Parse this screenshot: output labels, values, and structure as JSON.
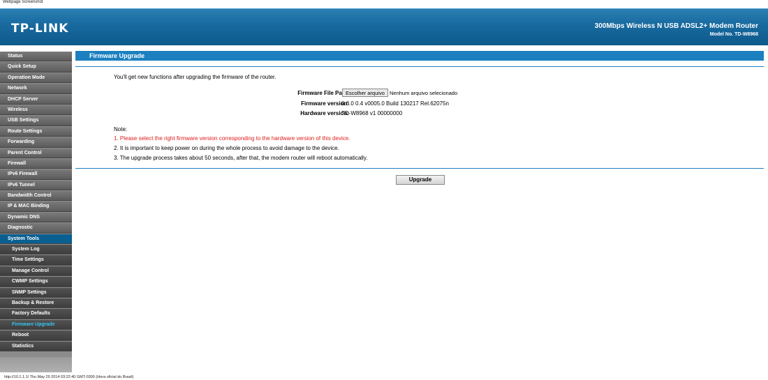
{
  "caption": "Webpage Screenshot",
  "header": {
    "logo": "TP-LINK",
    "product": "300Mbps Wireless N USB ADSL2+ Modem Router",
    "model": "Model No. TD-W8968"
  },
  "sidebar": {
    "items": [
      {
        "label": "Status",
        "type": "top"
      },
      {
        "label": "Quick Setup",
        "type": "top"
      },
      {
        "label": "Operation Mode",
        "type": "top"
      },
      {
        "label": "Network",
        "type": "top"
      },
      {
        "label": "DHCP Server",
        "type": "top"
      },
      {
        "label": "Wireless",
        "type": "top"
      },
      {
        "label": "USB Settings",
        "type": "top"
      },
      {
        "label": "Route Settings",
        "type": "top"
      },
      {
        "label": "Forwarding",
        "type": "top"
      },
      {
        "label": "Parent Control",
        "type": "top"
      },
      {
        "label": "Firewall",
        "type": "top"
      },
      {
        "label": "IPv6 Firewall",
        "type": "top"
      },
      {
        "label": "IPv6 Tunnel",
        "type": "top"
      },
      {
        "label": "Bandwidth Control",
        "type": "top"
      },
      {
        "label": "IP & MAC Binding",
        "type": "top"
      },
      {
        "label": "Dynamic DNS",
        "type": "top"
      },
      {
        "label": "Diagnostic",
        "type": "top"
      },
      {
        "label": "System Tools",
        "type": "active"
      },
      {
        "label": "System Log",
        "type": "sub"
      },
      {
        "label": "Time Settings",
        "type": "sub"
      },
      {
        "label": "Manage Control",
        "type": "sub"
      },
      {
        "label": "CWMP Settings",
        "type": "sub"
      },
      {
        "label": "SNMP Settings",
        "type": "sub"
      },
      {
        "label": "Backup & Restore",
        "type": "sub"
      },
      {
        "label": "Factory Defaults",
        "type": "sub"
      },
      {
        "label": "Firmware Upgrade",
        "type": "current"
      },
      {
        "label": "Reboot",
        "type": "sub"
      },
      {
        "label": "Statistics",
        "type": "sub"
      }
    ]
  },
  "main": {
    "title": "Firmware Upgrade",
    "intro": "You'll get new functions after upgrading the firmware of the router.",
    "file_path_label": "Firmware File Path:",
    "file_button": "Escolher arquivo",
    "file_status": "Nenhum arquivo selecionado",
    "firmware_label": "Firmware version:",
    "firmware_value": "0.6.0 0.4 v0005.0 Build 130217 Rel.62075n",
    "hardware_label": "Hardware version:",
    "hardware_value": "TD-W8968 v1 00000000",
    "note_title": "Note:",
    "notes": [
      "1. Please select the right firmware version corresponding to the hardware version of this device.",
      "2. It is important to keep power on during the whole process to avoid damage to the device.",
      "3. The upgrade process takes about 50 seconds, after that, the modem router will reboot automatically."
    ],
    "upgrade_button": "Upgrade"
  },
  "statusbar": "http://10.1.1.1/ Thu May 29 2014 03:22:40 GMT-0300 (Hora oficial do Brasil)",
  "colors": {
    "header": "#17699e",
    "accent": "#1c80c0",
    "warning": "#e01b1b",
    "current_menu": "#36c5f0"
  }
}
